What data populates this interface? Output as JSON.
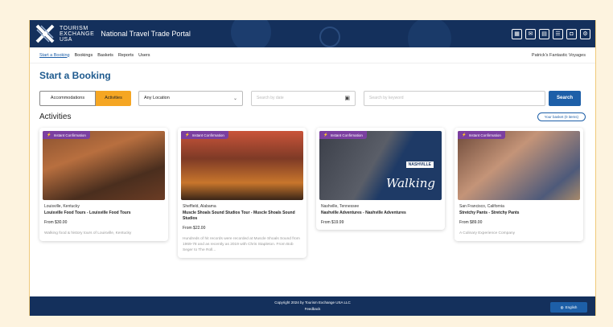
{
  "header": {
    "logo_line1": "TOURISM",
    "logo_line2": "EXCHANGE",
    "logo_line3": "USA",
    "portal_title": "National Travel Trade Portal",
    "icons": [
      "calendar-icon",
      "message-icon",
      "document-icon",
      "list-icon",
      "chat-icon",
      "settings-icon"
    ]
  },
  "nav": {
    "items": [
      "Start a Booking",
      "Bookings",
      "Baskets",
      "Reports",
      "Users"
    ],
    "company": "Patrick's Fantastic Voyages"
  },
  "page": {
    "title": "Start a Booking"
  },
  "search": {
    "tab_accommodations": "Accommodations",
    "tab_activities": "Activities",
    "location_value": "Any Location",
    "date_placeholder": "Search by date",
    "keyword_placeholder": "Search by keyword",
    "search_label": "Search"
  },
  "activities": {
    "section_title": "Activities",
    "basket_label": "Your basket (0 items)",
    "cards": [
      {
        "badge": "Instant Confirmation",
        "location": "Louisville, Kentucky",
        "name": "Louisville Food Tours - Louisville Food Tours",
        "price": "From $30.00",
        "description": "Walking food & history tours of Louisville, Kentucky"
      },
      {
        "badge": "Instant Confirmation",
        "location": "Sheffield, Alabama",
        "name": "Muscle Shoals Sound Studios Tour - Muscle Shoals Sound Studios",
        "price": "From $22.00",
        "description": "Hundreds of hit records were recorded at Muscle Shoals Sound from 1969-78 and as recently as 2019 with Chris Stapleton. From Bob Seger to The Roll..."
      },
      {
        "badge": "Instant Confirmation",
        "location": "Nashville, Tennessee",
        "name": "Nashville Adventures - Nashville Adventures",
        "price": "From $19.99",
        "description": "",
        "image_text": "Walking",
        "image_tag": "NASHVILLE"
      },
      {
        "badge": "Instant Confirmation",
        "location": "San Francisco, California",
        "name": "Stretchy Pants - Stretchy Pants",
        "price": "From $89.00",
        "description": "A Culinary Experience Company"
      }
    ]
  },
  "footer": {
    "copyright": "Copyright 2024 by Tourism Exchange USA LLC",
    "feedback": "Feedback",
    "language": "English"
  },
  "colors": {
    "header_bg": "#14305c",
    "accent_blue": "#1d5fa8",
    "activities_tab": "#f5a623",
    "badge_purple": "#7b3fa0",
    "page_bg": "#fdf3df"
  }
}
